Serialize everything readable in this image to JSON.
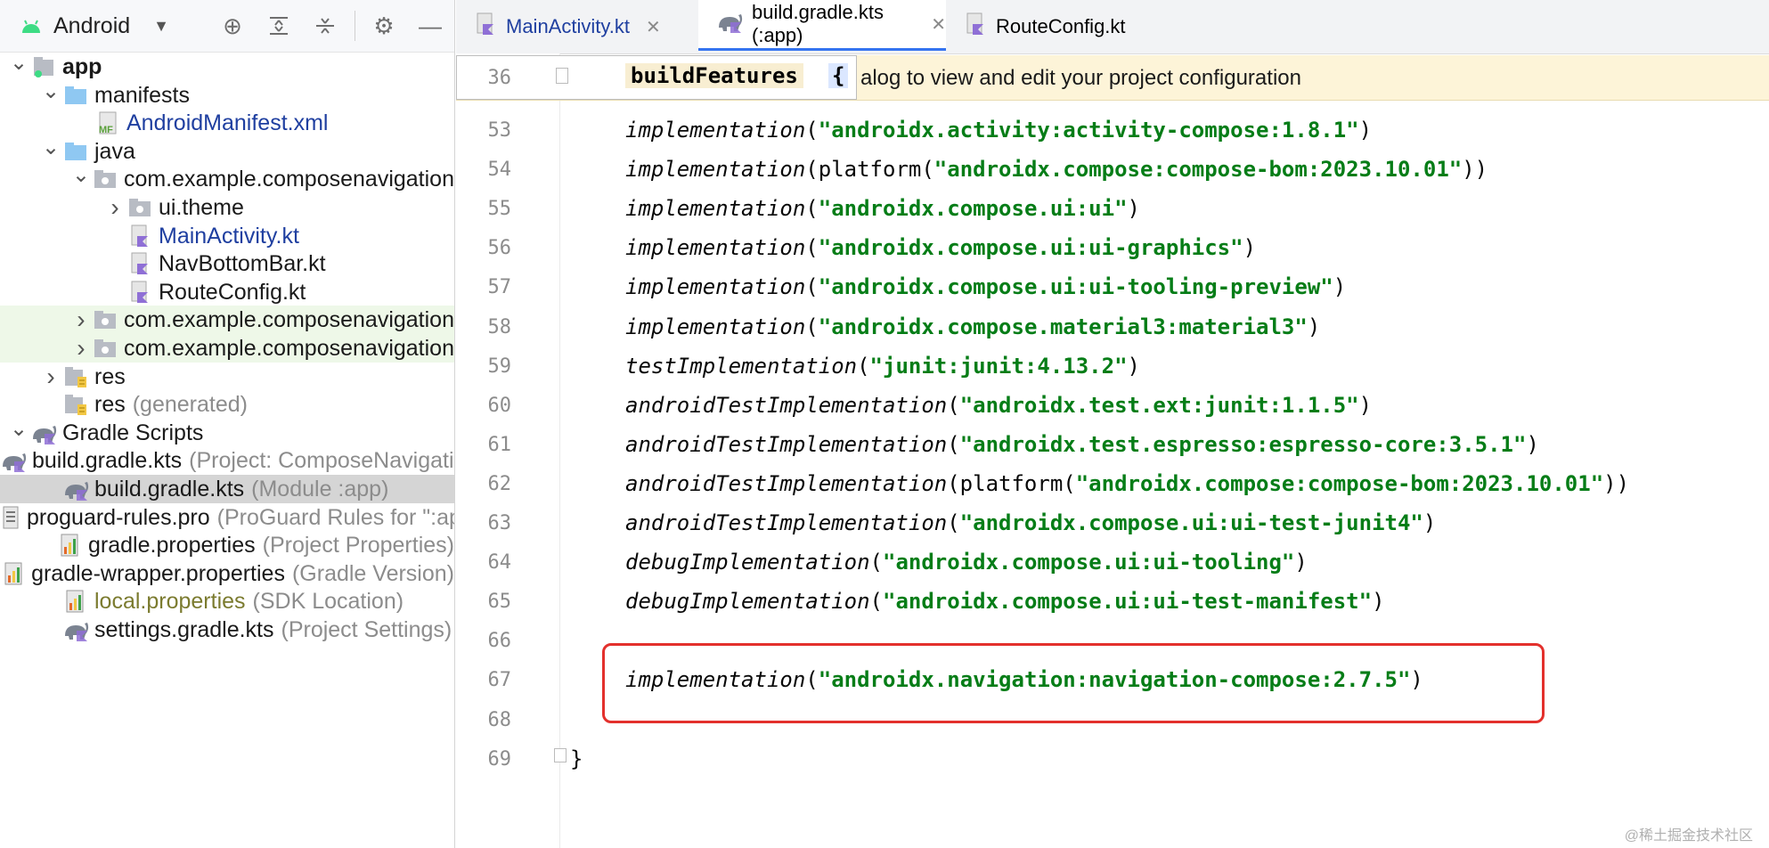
{
  "project": {
    "view_selector": "Android",
    "toolbar_icons": [
      "target-icon",
      "expand-all-icon",
      "collapse-all-icon",
      "gear-icon",
      "minimize-icon"
    ],
    "tree": [
      {
        "depth": 0,
        "arrow": "down",
        "icon": "module",
        "label": "app",
        "style": "bold"
      },
      {
        "depth": 1,
        "arrow": "down",
        "icon": "folder",
        "label": "manifests"
      },
      {
        "depth": 2,
        "arrow": "",
        "icon": "manifest",
        "label": "AndroidManifest.xml",
        "style": "blue"
      },
      {
        "depth": 1,
        "arrow": "down",
        "icon": "folder",
        "label": "java"
      },
      {
        "depth": 2,
        "arrow": "down",
        "icon": "package",
        "label": "com.example.composenavigation"
      },
      {
        "depth": 3,
        "arrow": "right",
        "icon": "package",
        "label": "ui.theme"
      },
      {
        "depth": 3,
        "arrow": "",
        "icon": "kotlin",
        "label": "MainActivity.kt",
        "style": "blue"
      },
      {
        "depth": 3,
        "arrow": "",
        "icon": "kotlin",
        "label": "NavBottomBar.kt"
      },
      {
        "depth": 3,
        "arrow": "",
        "icon": "kotlin",
        "label": "RouteConfig.kt"
      },
      {
        "depth": 2,
        "arrow": "right",
        "icon": "package",
        "label": "com.example.composenavigation",
        "row": "green"
      },
      {
        "depth": 2,
        "arrow": "right",
        "icon": "package",
        "label": "com.example.composenavigation",
        "row": "green"
      },
      {
        "depth": 1,
        "arrow": "right",
        "icon": "res",
        "label": "res"
      },
      {
        "depth": 1,
        "arrow": "",
        "icon": "res",
        "label": "res",
        "hint": "(generated)"
      },
      {
        "depth": 0,
        "arrow": "down",
        "icon": "gradle",
        "label": "Gradle Scripts"
      },
      {
        "depth": 1,
        "arrow": "",
        "icon": "gradle",
        "label": "build.gradle.kts",
        "hint": "(Project: ComposeNavigation)"
      },
      {
        "depth": 1,
        "arrow": "",
        "icon": "gradle",
        "label": "build.gradle.kts",
        "hint": "(Module :app)",
        "row": "sel"
      },
      {
        "depth": 1,
        "arrow": "",
        "icon": "text",
        "label": "proguard-rules.pro",
        "hint": "(ProGuard Rules for \":app\")"
      },
      {
        "depth": 1,
        "arrow": "",
        "icon": "props",
        "label": "gradle.properties",
        "hint": "(Project Properties)"
      },
      {
        "depth": 1,
        "arrow": "",
        "icon": "props",
        "label": "gradle-wrapper.properties",
        "hint": "(Gradle Version)"
      },
      {
        "depth": 1,
        "arrow": "",
        "icon": "props",
        "label": "local.properties",
        "hint": "(SDK Location)",
        "style": "olive"
      },
      {
        "depth": 1,
        "arrow": "",
        "icon": "gradle",
        "label": "settings.gradle.kts",
        "hint": "(Project Settings)"
      }
    ]
  },
  "editor": {
    "tabs": [
      {
        "label": "MainActivity.kt",
        "icon": "kotlin-file-icon",
        "active": false,
        "style": "blue"
      },
      {
        "label": "build.gradle.kts (:app)",
        "icon": "gradle-file-icon",
        "active": true
      },
      {
        "label": "RouteConfig.kt",
        "icon": "kotlin-file-icon",
        "active": false
      }
    ],
    "sticky": {
      "line": "36",
      "code": "buildFeatures",
      "brace": "{",
      "banner": "alog to view and edit your project configuration"
    },
    "lines": [
      {
        "n": "53",
        "fn": "implementation",
        "args": [
          [
            "(",
            ""
          ],
          [
            "\"androidx.activity:activity-compose:1.8.1\"",
            "str"
          ],
          [
            ")",
            ""
          ]
        ]
      },
      {
        "n": "54",
        "fn": "implementation",
        "args": [
          [
            "(platform(",
            ""
          ],
          [
            "\"androidx.compose:compose-bom:2023.10.01\"",
            "str"
          ],
          [
            "))",
            ""
          ]
        ]
      },
      {
        "n": "55",
        "fn": "implementation",
        "args": [
          [
            "(",
            ""
          ],
          [
            "\"androidx.compose.ui:ui\"",
            "str"
          ],
          [
            ")",
            ""
          ]
        ]
      },
      {
        "n": "56",
        "fn": "implementation",
        "args": [
          [
            "(",
            ""
          ],
          [
            "\"androidx.compose.ui:ui-graphics\"",
            "str"
          ],
          [
            ")",
            ""
          ]
        ]
      },
      {
        "n": "57",
        "fn": "implementation",
        "args": [
          [
            "(",
            ""
          ],
          [
            "\"androidx.compose.ui:ui-tooling-preview\"",
            "str"
          ],
          [
            ")",
            ""
          ]
        ]
      },
      {
        "n": "58",
        "fn": "implementation",
        "args": [
          [
            "(",
            ""
          ],
          [
            "\"androidx.compose.material3:material3\"",
            "str"
          ],
          [
            ")",
            ""
          ]
        ]
      },
      {
        "n": "59",
        "fn": "testImplementation",
        "args": [
          [
            "(",
            ""
          ],
          [
            "\"junit:junit:4.13.2\"",
            "str"
          ],
          [
            ")",
            ""
          ]
        ]
      },
      {
        "n": "60",
        "fn": "androidTestImplementation",
        "args": [
          [
            "(",
            ""
          ],
          [
            "\"androidx.test.ext:junit:1.1.5\"",
            "str"
          ],
          [
            ")",
            ""
          ]
        ]
      },
      {
        "n": "61",
        "fn": "androidTestImplementation",
        "args": [
          [
            "(",
            ""
          ],
          [
            "\"androidx.test.espresso:espresso-core:3.5.1\"",
            "str"
          ],
          [
            ")",
            ""
          ]
        ]
      },
      {
        "n": "62",
        "fn": "androidTestImplementation",
        "args": [
          [
            "(platform(",
            ""
          ],
          [
            "\"androidx.compose:compose-bom:2023.10.01\"",
            "str"
          ],
          [
            "))",
            ""
          ]
        ]
      },
      {
        "n": "63",
        "fn": "androidTestImplementation",
        "args": [
          [
            "(",
            ""
          ],
          [
            "\"androidx.compose.ui:ui-test-junit4\"",
            "str"
          ],
          [
            ")",
            ""
          ]
        ]
      },
      {
        "n": "64",
        "fn": "debugImplementation",
        "args": [
          [
            "(",
            ""
          ],
          [
            "\"androidx.compose.ui:ui-tooling\"",
            "str"
          ],
          [
            ")",
            ""
          ]
        ]
      },
      {
        "n": "65",
        "fn": "debugImplementation",
        "args": [
          [
            "(",
            ""
          ],
          [
            "\"androidx.compose.ui:ui-test-manifest\"",
            "str"
          ],
          [
            ")",
            ""
          ]
        ]
      },
      {
        "n": "66",
        "fn": "",
        "args": []
      },
      {
        "n": "67",
        "fn": "implementation",
        "args": [
          [
            "(",
            ""
          ],
          [
            "\"androidx.navigation:navigation-compose:2.7.5\"",
            "str"
          ],
          [
            ")",
            ""
          ]
        ]
      },
      {
        "n": "68",
        "fn": "",
        "args": []
      },
      {
        "n": "69",
        "fn": "",
        "args": [
          [
            "}",
            ""
          ]
        ],
        "indent": 0
      }
    ]
  },
  "watermark": "@稀土掘金技术社区",
  "colors": {
    "string": "#067d17",
    "accent": "#3574f0",
    "highlight_box": "#e3302c",
    "selected_row": "#d5d5d5",
    "new_row": "#eef8e8"
  }
}
